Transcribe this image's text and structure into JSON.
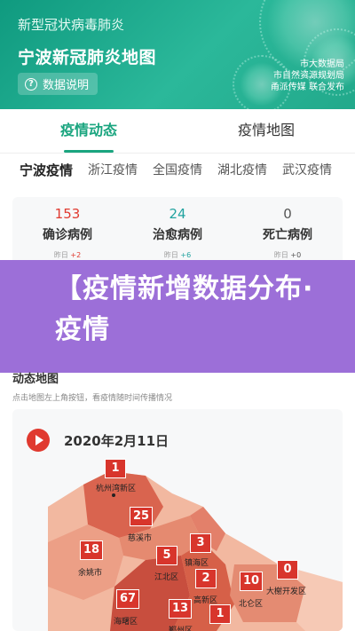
{
  "header": {
    "subtitle": "新型冠状病毒肺炎",
    "title": "宁波新冠肺炎地图",
    "data_button": {
      "icon": "info-icon",
      "label": "数据说明"
    },
    "sources": [
      "市大数据局",
      "市自然资源规划局",
      "甬派传媒 联合发布"
    ]
  },
  "main_tabs": [
    {
      "label": "疫情动态",
      "active": true
    },
    {
      "label": "疫情地图",
      "active": false
    }
  ],
  "region_tabs": [
    "宁波疫情",
    "浙江疫情",
    "全国疫情",
    "湖北疫情",
    "武汉疫情"
  ],
  "stats": [
    {
      "value": "153",
      "label": "确诊病例",
      "delta_label": "昨日",
      "delta": "+2",
      "color": "#e0392f"
    },
    {
      "value": "24",
      "label": "治愈病例",
      "delta_label": "昨日",
      "delta": "+6",
      "color": "#22a3a0"
    },
    {
      "value": "0",
      "label": "死亡病例",
      "delta_label": "昨日",
      "delta": "+0",
      "color": "#555555"
    }
  ],
  "banner": {
    "text": "【疫情新增数据分布·疫情"
  },
  "map_section": {
    "title": "动态地图",
    "hint": "点击地图左上角按钮，看疫情随时间传播情况",
    "date": "2020年2月11日",
    "regions": [
      {
        "name": "杭州湾新区",
        "count": "1"
      },
      {
        "name": "慈溪市",
        "count": "25"
      },
      {
        "name": "镇海区",
        "count": "3"
      },
      {
        "name": "余姚市",
        "count": "18"
      },
      {
        "name": "江北区",
        "count": "5"
      },
      {
        "name": "高新区",
        "count": "2"
      },
      {
        "name": "北仑区",
        "count": "10"
      },
      {
        "name": "大榭开发区",
        "count": "0"
      },
      {
        "name": "海曙区",
        "count": "67"
      },
      {
        "name": "鄞州区",
        "count": "13"
      },
      {
        "name": "",
        "count": "1"
      }
    ]
  },
  "colors": {
    "brand_green": "#1aa57f",
    "badge_red": "#d8352c",
    "banner_purple": "#9c6fd8"
  }
}
